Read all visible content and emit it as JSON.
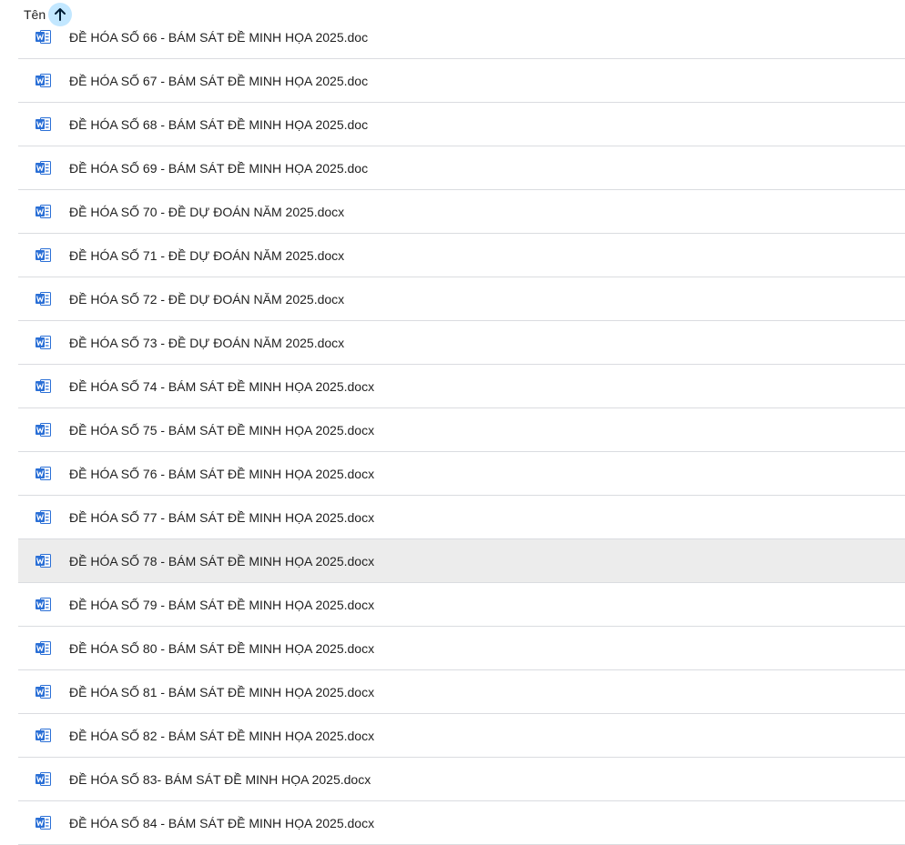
{
  "header": {
    "column_label": "Tên",
    "sort_icon": "arrow-up-icon"
  },
  "colors": {
    "sort_button_bg": "#c2e7ff",
    "word_icon_blue": "#2a6fd6",
    "selected_row_bg": "#ececec",
    "divider": "#dadce0"
  },
  "files": [
    {
      "name": "ĐỀ HÓA SỐ 66 - BÁM SÁT ĐỀ MINH HỌA 2025.doc",
      "icon": "word-doc-icon",
      "selected": false
    },
    {
      "name": "ĐỀ HÓA SỐ 67 - BÁM SÁT ĐỀ MINH HỌA 2025.doc",
      "icon": "word-doc-icon",
      "selected": false
    },
    {
      "name": "ĐỀ HÓA SỐ 68 - BÁM SÁT ĐỀ MINH HỌA 2025.doc",
      "icon": "word-doc-icon",
      "selected": false
    },
    {
      "name": "ĐỀ HÓA SỐ 69 - BÁM SÁT ĐỀ MINH HỌA 2025.doc",
      "icon": "word-doc-icon",
      "selected": false
    },
    {
      "name": "ĐỀ HÓA SỐ 70 - ĐỀ DỰ ĐOÁN NĂM 2025.docx",
      "icon": "word-doc-icon",
      "selected": false
    },
    {
      "name": "ĐỀ HÓA SỐ 71 - ĐỀ DỰ ĐOÁN NĂM 2025.docx",
      "icon": "word-doc-icon",
      "selected": false
    },
    {
      "name": "ĐỀ HÓA SỐ 72 - ĐỀ DỰ ĐOÁN NĂM 2025.docx",
      "icon": "word-doc-icon",
      "selected": false
    },
    {
      "name": "ĐỀ HÓA SỐ 73 - ĐỀ DỰ ĐOÁN NĂM 2025.docx",
      "icon": "word-doc-icon",
      "selected": false
    },
    {
      "name": "ĐỀ HÓA SỐ 74 - BÁM SÁT ĐỀ MINH HỌA 2025.docx",
      "icon": "word-doc-icon",
      "selected": false
    },
    {
      "name": "ĐỀ HÓA SỐ 75 - BÁM SÁT ĐỀ MINH HỌA 2025.docx",
      "icon": "word-doc-icon",
      "selected": false
    },
    {
      "name": "ĐỀ HÓA SỐ 76 - BÁM SÁT ĐỀ MINH HỌA 2025.docx",
      "icon": "word-doc-icon",
      "selected": false
    },
    {
      "name": "ĐỀ HÓA SỐ 77 - BÁM SÁT ĐỀ MINH HỌA 2025.docx",
      "icon": "word-doc-icon",
      "selected": false
    },
    {
      "name": "ĐỀ HÓA SỐ 78 - BÁM SÁT ĐỀ MINH HỌA 2025.docx",
      "icon": "word-doc-icon",
      "selected": true
    },
    {
      "name": "ĐỀ HÓA SỐ 79 - BÁM SÁT ĐỀ MINH HỌA 2025.docx",
      "icon": "word-doc-icon",
      "selected": false
    },
    {
      "name": "ĐỀ HÓA SỐ 80 - BÁM SÁT ĐỀ MINH HỌA 2025.docx",
      "icon": "word-doc-icon",
      "selected": false
    },
    {
      "name": "ĐỀ HÓA SỐ 81 - BÁM SÁT ĐỀ MINH HỌA 2025.docx",
      "icon": "word-doc-icon",
      "selected": false
    },
    {
      "name": "ĐỀ HÓA SỐ 82 - BÁM SÁT ĐỀ MINH HỌA 2025.docx",
      "icon": "word-doc-icon",
      "selected": false
    },
    {
      "name": "ĐỀ HÓA SỐ 83- BÁM SÁT ĐỀ MINH HỌA 2025.docx",
      "icon": "word-doc-icon",
      "selected": false
    },
    {
      "name": "ĐỀ HÓA SỐ 84 - BÁM SÁT ĐỀ MINH HỌA 2025.docx",
      "icon": "word-doc-icon",
      "selected": false
    }
  ]
}
